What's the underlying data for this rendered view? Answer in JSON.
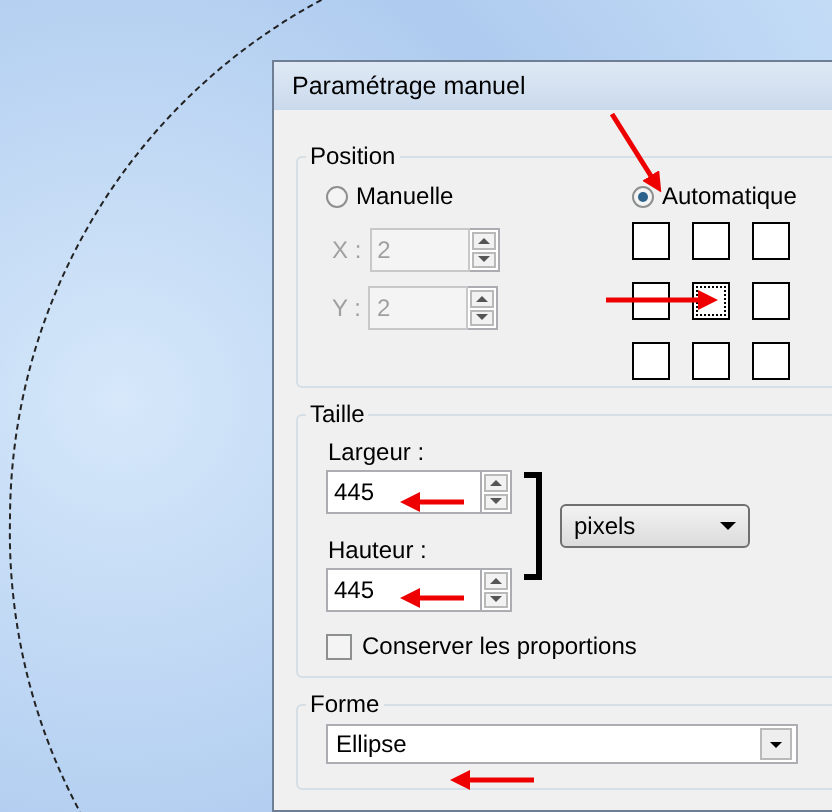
{
  "title": "Paramétrage manuel",
  "position": {
    "legend": "Position",
    "modes": [
      {
        "label": "Manuelle",
        "selected": false
      },
      {
        "label": "Automatique",
        "selected": true
      }
    ],
    "fields": [
      {
        "label": "X :",
        "value": "2",
        "disabled": true
      },
      {
        "label": "Y :",
        "value": "2",
        "disabled": true
      }
    ],
    "anchor_grid": [
      {
        "selected": false
      },
      {
        "selected": false
      },
      {
        "selected": false
      },
      {
        "selected": false
      },
      {
        "selected": true
      },
      {
        "selected": false
      },
      {
        "selected": false
      },
      {
        "selected": false
      },
      {
        "selected": false
      }
    ]
  },
  "size": {
    "legend": "Taille",
    "fields": [
      {
        "label": "Largeur :",
        "value": "445"
      },
      {
        "label": "Hauteur :",
        "value": "445"
      }
    ],
    "unit": "pixels",
    "keep_proportions": {
      "label": "Conserver les proportions",
      "checked": false
    }
  },
  "shape": {
    "legend": "Forme",
    "value": "Ellipse"
  }
}
